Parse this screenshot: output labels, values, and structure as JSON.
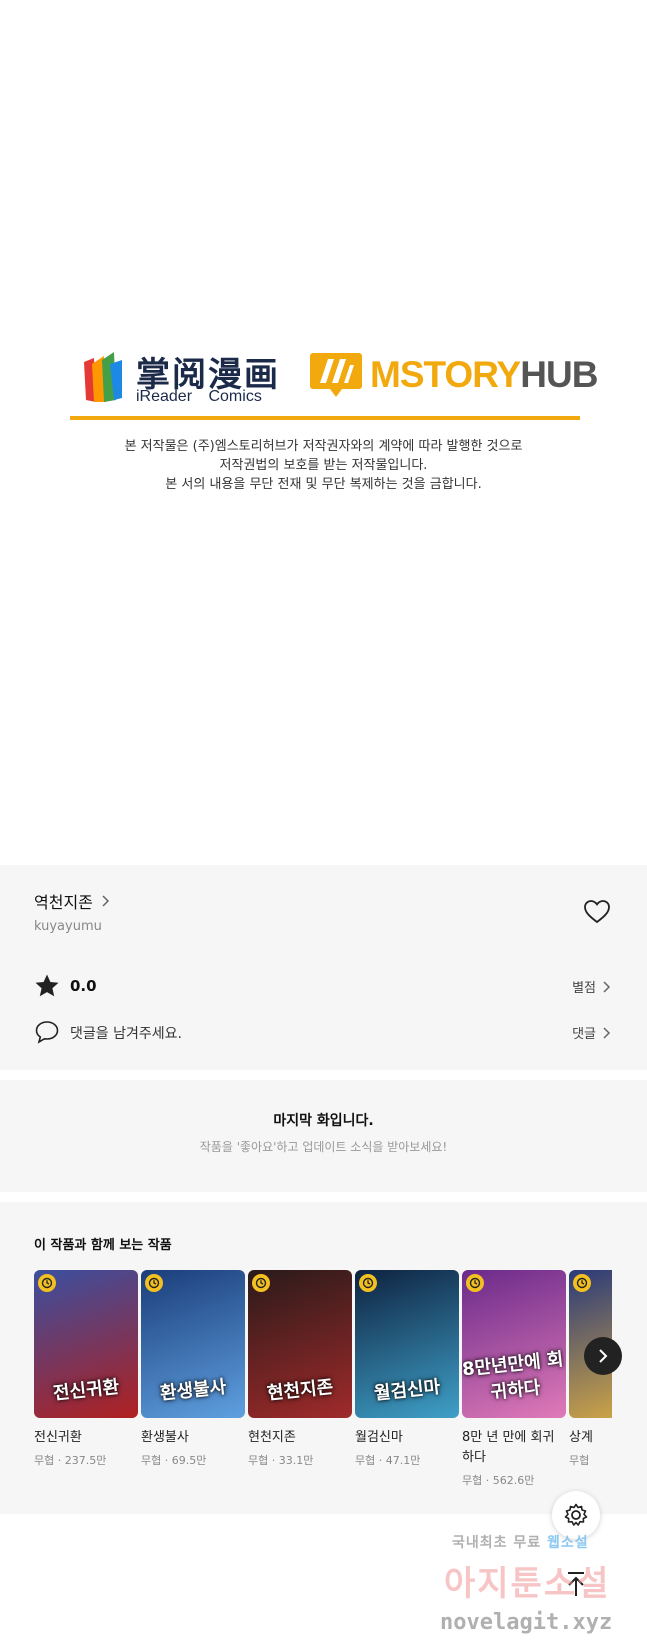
{
  "publisher": {
    "ireader_cn": "掌阅漫画",
    "ireader_en": "iReader Comics",
    "mstory_orange": "MSTORY",
    "mstory_gray": "HUB",
    "copyright_lines": [
      "본 저작물은 (주)엠스토리허브가 저작권자와의 계약에 따라 발행한 것으로",
      "저작권법의 보호를 받는 저작물입니다.",
      "본 서의 내용을 무단 전재 및 무단 복제하는 것을 금합니다."
    ]
  },
  "work": {
    "title": "역천지존",
    "author": "kuyayumu",
    "rating": "0.0",
    "rate_label": "별점",
    "comment_prompt": "댓글을 남겨주세요.",
    "comment_label": "댓글"
  },
  "last_episode": {
    "title": "마지막 화입니다.",
    "subtitle": "작품을 '좋아요'하고 업데이트 소식을 받아보세요!"
  },
  "recommendations": {
    "heading": "이 작품과 함께 보는 작품",
    "items": [
      {
        "name": "전신귀환",
        "meta": "무협 · 237.5만",
        "cover_text": "전신귀환",
        "c1": "#3a4fa0",
        "c2": "#b02020"
      },
      {
        "name": "환생불사",
        "meta": "무협 · 69.5만",
        "cover_text": "환생불사",
        "c1": "#1b3d7a",
        "c2": "#5fa0e0"
      },
      {
        "name": "현천지존",
        "meta": "무협 · 33.1만",
        "cover_text": "현천지존",
        "c1": "#2a1a1a",
        "c2": "#a02a2a"
      },
      {
        "name": "월검신마",
        "meta": "무협 · 47.1만",
        "cover_text": "월검신마",
        "c1": "#0e2240",
        "c2": "#3fa0c8"
      },
      {
        "name": "8만 년 만에 회귀하다",
        "meta": "무협 · 562.6만",
        "cover_text": "8만년만에 회귀하다",
        "c1": "#6a2a8a",
        "c2": "#e07ab8"
      },
      {
        "name": "상계",
        "meta": "무협",
        "cover_text": "",
        "c1": "#2a3a7a",
        "c2": "#e0b040"
      }
    ]
  },
  "watermark": {
    "line1_a": "국내최초 무료",
    "line1_b": "웹소설",
    "line2": "아지툰소설",
    "line3": "novelagit.xyz"
  },
  "colors": {
    "accent": "#f2a90d",
    "panel_bg": "#f6f6f6",
    "clock_badge": "#f3c021"
  },
  "icons": [
    "star-icon",
    "heart-icon",
    "comment-icon",
    "chevron-right-icon",
    "clock-icon",
    "gear-icon",
    "arrow-up-icon"
  ]
}
